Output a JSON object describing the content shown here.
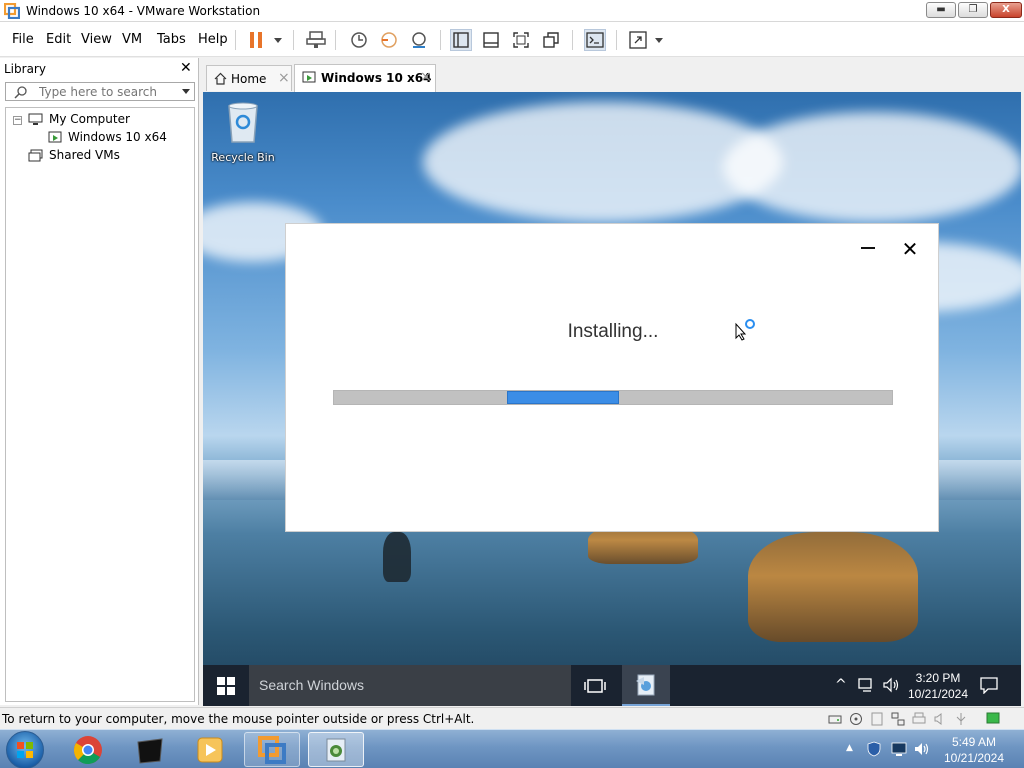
{
  "window": {
    "title": "Windows 10 x64 - VMware Workstation",
    "minimize_glyph": "▬",
    "restore_glyph": "❐",
    "close_glyph": "X"
  },
  "menu": {
    "file": "File",
    "edit": "Edit",
    "view": "View",
    "vm": "VM",
    "tabs": "Tabs",
    "help": "Help"
  },
  "toolbar": {
    "icons": [
      "pause-icon",
      "send-ctrl-alt-del-icon",
      "snapshot-icon",
      "revert-snapshot-icon",
      "snapshot-manager-icon",
      "show-library-icon",
      "thumbnail-bar-icon",
      "full-screen-icon",
      "unity-icon",
      "console-view-icon",
      "stretch-guest-icon"
    ],
    "accent_color": "#e8742a"
  },
  "library": {
    "title": "Library",
    "close_glyph": "✕",
    "search_placeholder": "Type here to search",
    "tree": {
      "my_computer": "My Computer",
      "vm_item": "Windows 10 x64",
      "shared_vms": "Shared VMs",
      "collapse_glyph": "−"
    }
  },
  "tabs": {
    "home": "Home",
    "vm": "Windows 10 x64",
    "close_glyph": "×"
  },
  "guest": {
    "desktop_icon": "Recycle Bin",
    "installer": {
      "status": "Installing...",
      "progress_segment_start": 0.31,
      "progress_segment_end": 0.51,
      "close_glyph": "✕"
    },
    "taskbar": {
      "search_placeholder": "Search Windows",
      "time": "3:20 PM",
      "date": "10/21/2024",
      "tray_up_glyph": "^"
    }
  },
  "statusbar": {
    "message": "To return to your computer, move the mouse pointer outside or press Ctrl+Alt."
  },
  "host_taskbar": {
    "apps": [
      "windows-start-icon",
      "chrome-icon",
      "terminal-icon",
      "media-player-icon",
      "vmware-workstation-icon",
      "installer-app-icon"
    ],
    "time": "5:49 AM",
    "date": "10/21/2024",
    "tray_arrow_glyph": "▲"
  }
}
